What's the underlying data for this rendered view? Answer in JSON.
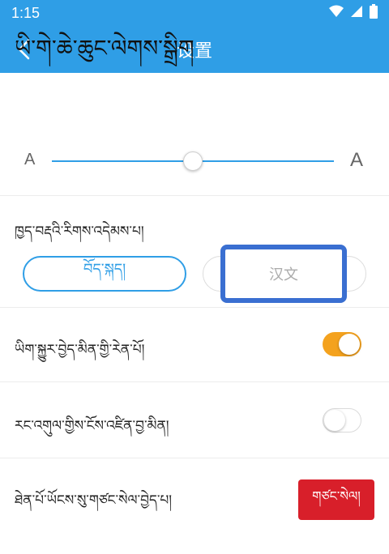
{
  "status_bar": {
    "time": "1:15"
  },
  "app_bar": {
    "title": "设置"
  },
  "font_size": {
    "title": "ཡི་གེ་ཆེ་ཆུང་ལེགས་སྒྲིག",
    "small_label": "A",
    "large_label": "A",
    "level": 0.5
  },
  "language": {
    "label": "ཁྱད་བརྡའི་རིགས་འདེམས་པ།",
    "options": [
      "བོད་སྐད།",
      "汉文"
    ]
  },
  "settings": {
    "push_label": "ཡིག་སྐྱུར་བྱེད་མིན་གྱི་རེན་པོ།",
    "auto_label": "རང་འགུལ་གྱིས་ངོས་འཛིན་བྱ་མིན།",
    "logout_label": "ཐེན་པོ་ཡོངས་སུ་གཙང་སེལ་བྱེད་པ།",
    "logout_button": "གཙང་སེལ།"
  },
  "colors": {
    "primary": "#2f9ee6",
    "toggle_on": "#f4a21e",
    "danger": "#d81f2a",
    "highlight": "#3a6fd1"
  }
}
